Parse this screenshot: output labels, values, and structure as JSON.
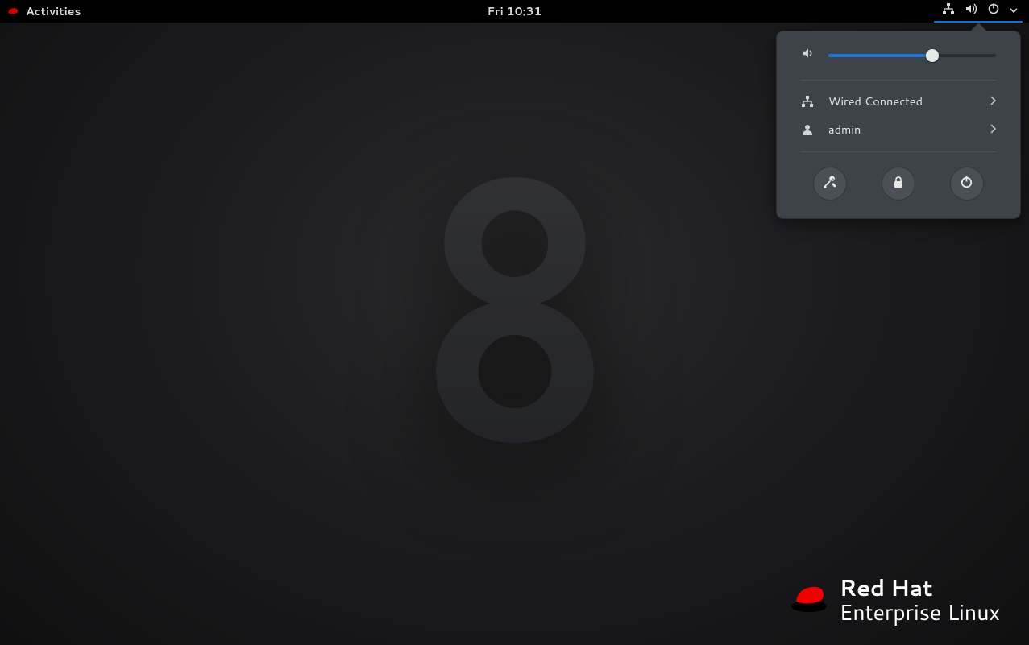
{
  "topbar": {
    "activities_label": "Activities",
    "clock": "Fri 10:31"
  },
  "popup": {
    "volume_percent": 62,
    "network_label": "Wired Connected",
    "user_label": "admin"
  },
  "brand": {
    "line1": "Red Hat",
    "line2": "Enterprise Linux"
  }
}
